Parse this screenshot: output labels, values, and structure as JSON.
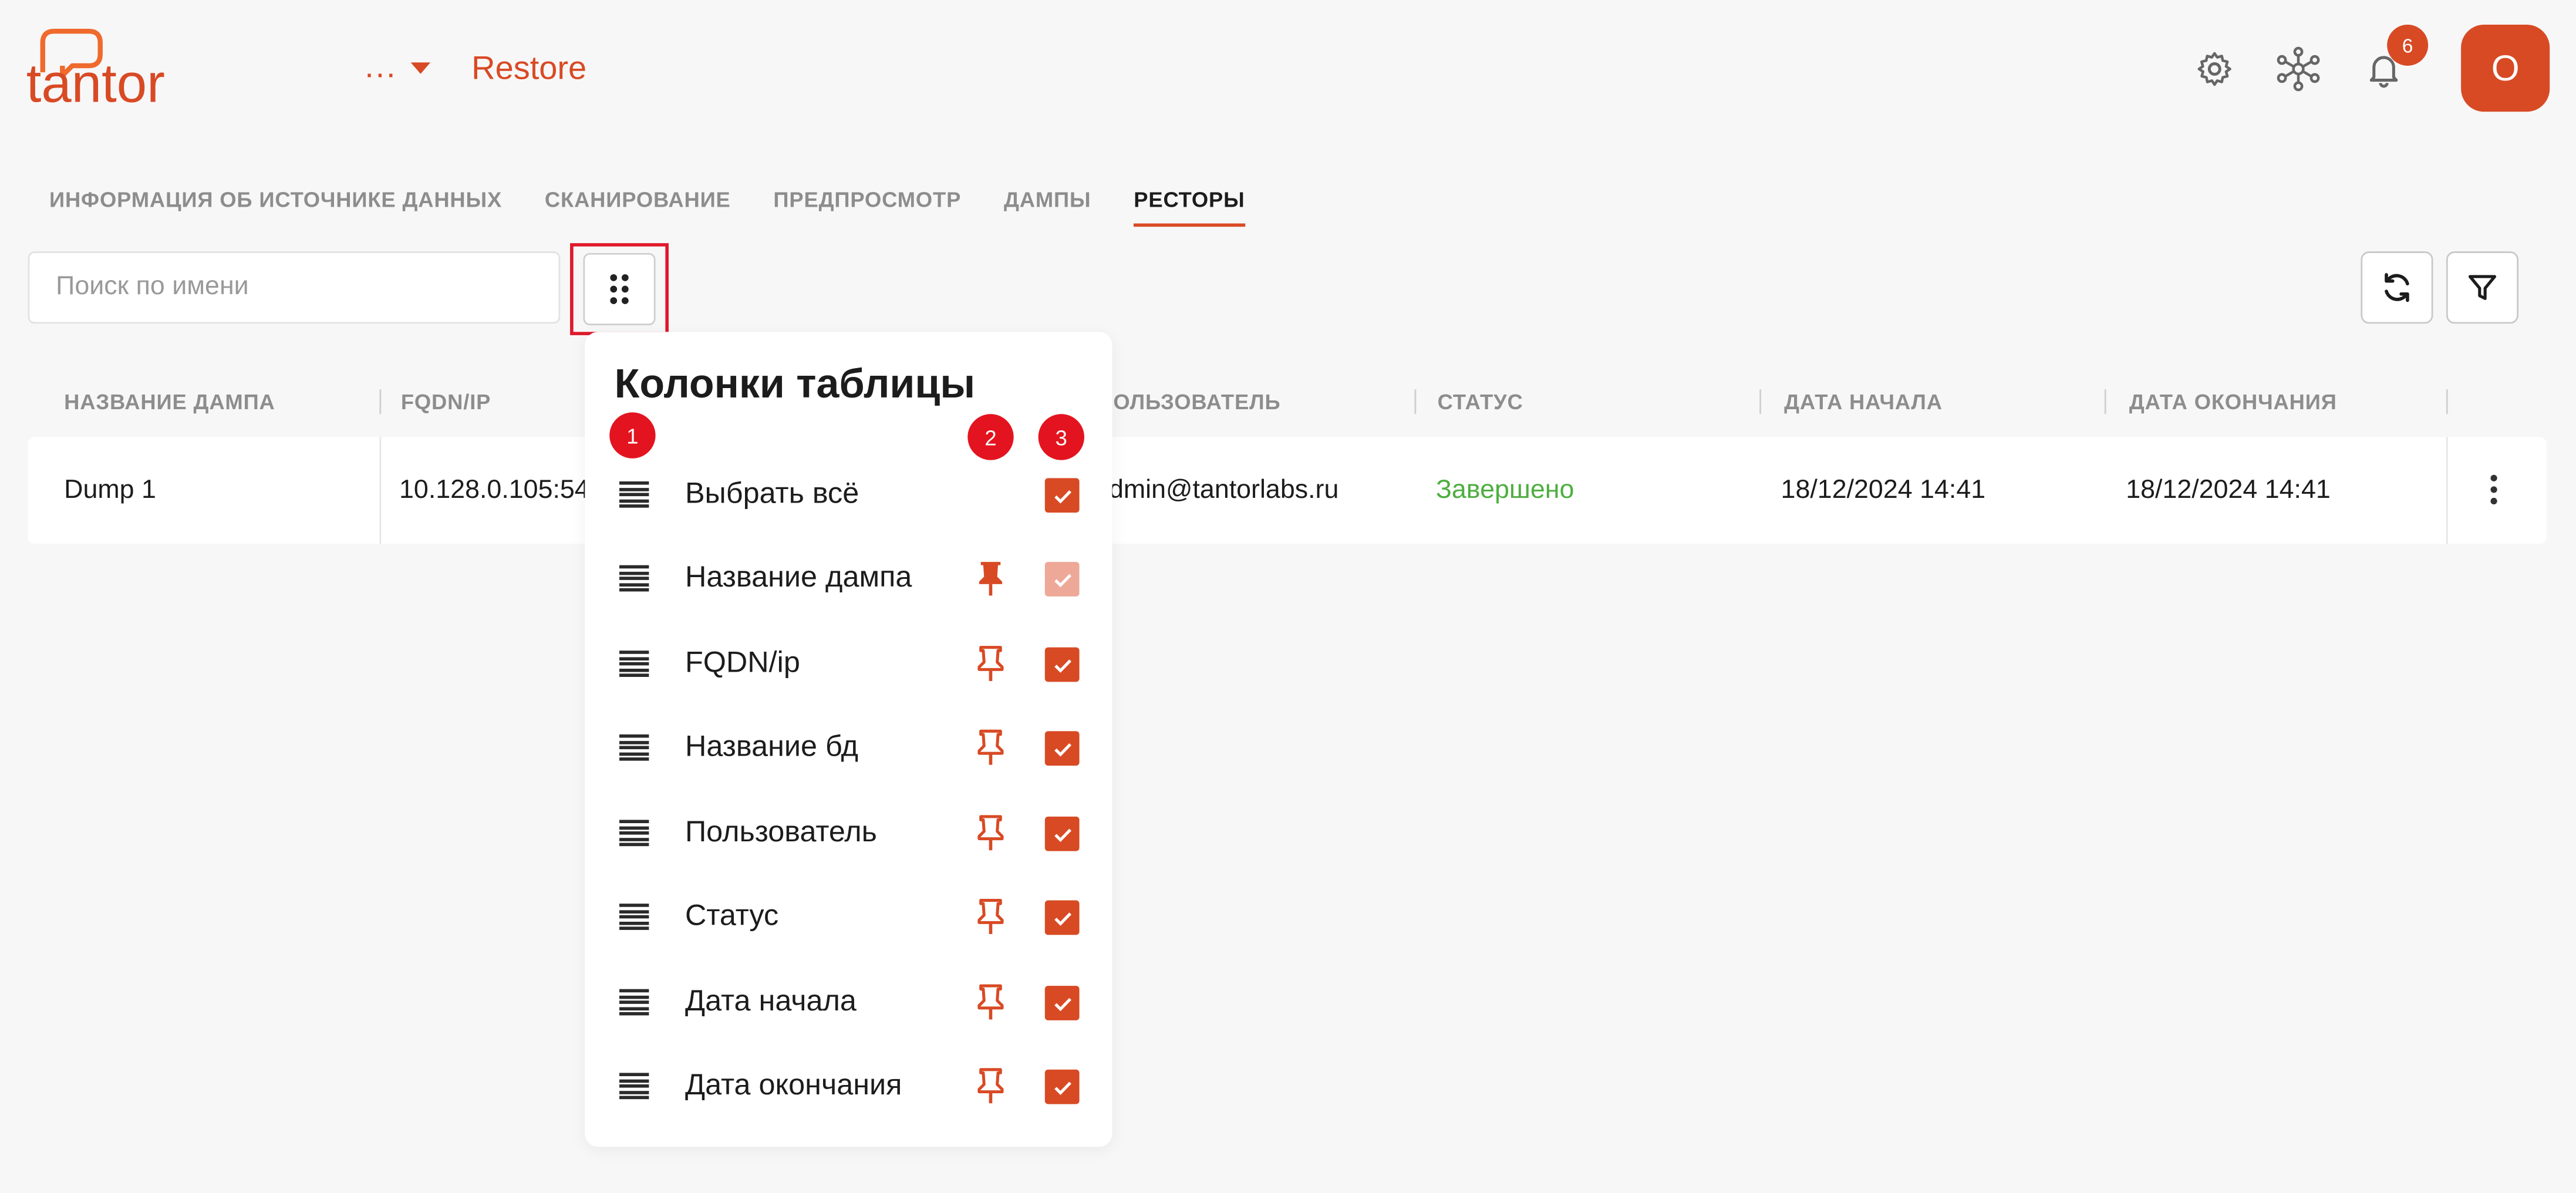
{
  "header": {
    "logo_text": "tantor",
    "breadcrumb_dots": "...",
    "title": "Restore",
    "notifications_count": "6",
    "avatar_letter": "O",
    "icons": [
      "gear-icon",
      "network-icon",
      "bell-icon"
    ]
  },
  "tabs": [
    {
      "label": "ИНФОРМАЦИЯ ОБ ИСТОЧНИКЕ ДАННЫХ",
      "active": false
    },
    {
      "label": "СКАНИРОВАНИЕ",
      "active": false
    },
    {
      "label": "ПРЕДПРОСМОТР",
      "active": false
    },
    {
      "label": "ДАМПЫ",
      "active": false
    },
    {
      "label": "РЕСТОРЫ",
      "active": true
    }
  ],
  "toolbar": {
    "search_placeholder": "Поиск по имени",
    "columns_icon": "dots-grid-icon",
    "refresh_icon": "refresh-icon",
    "filter_icon": "filter-icon"
  },
  "table": {
    "headers": [
      "НАЗВАНИЕ ДАМПА",
      "FQDN/IP",
      "ПОЛЬЗОВАТЕЛЬ",
      "СТАТУС",
      "ДАТА НАЧАЛА",
      "ДАТА ОКОНЧАНИЯ"
    ],
    "rows": [
      {
        "name": "Dump 1",
        "fqdn": "10.128.0.105:543",
        "user": "dmin@tantorlabs.ru",
        "status": "Завершено",
        "start": "18/12/2024 14:41",
        "end": "18/12/2024 14:41"
      }
    ]
  },
  "columns_popover": {
    "title": "Колонки таблицы",
    "markers": [
      "1",
      "2",
      "3"
    ],
    "items": [
      {
        "label": "Выбрать всё",
        "pinned": null,
        "checked": true,
        "disabled": false
      },
      {
        "label": "Название дампа",
        "pinned": true,
        "checked": true,
        "disabled": true
      },
      {
        "label": "FQDN/ip",
        "pinned": false,
        "checked": true,
        "disabled": false
      },
      {
        "label": "Название бд",
        "pinned": false,
        "checked": true,
        "disabled": false
      },
      {
        "label": "Пользователь",
        "pinned": false,
        "checked": true,
        "disabled": false
      },
      {
        "label": "Статус",
        "pinned": false,
        "checked": true,
        "disabled": false
      },
      {
        "label": "Дата начала",
        "pinned": false,
        "checked": true,
        "disabled": false
      },
      {
        "label": "Дата окончания",
        "pinned": false,
        "checked": true,
        "disabled": false
      }
    ]
  },
  "colors": {
    "accent": "#d84a24",
    "status_ok": "#4caf3e",
    "marker": "#e3141f"
  }
}
